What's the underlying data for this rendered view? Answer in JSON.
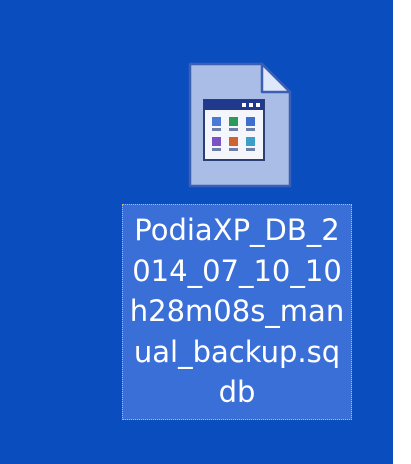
{
  "desktop": {
    "background_color": "#0a4dbe",
    "selected_file": {
      "icon": "database-file-icon",
      "name": "PodiaXP_DB_2014_07_10_10h28m08s_manual_backup.sqdb",
      "label_lines": [
        "PodiaXP_DB_2",
        "014_07_10_10",
        "h28m08s_man",
        "ual_backup.sq",
        "db"
      ],
      "selection_color": "#3a6fd8"
    }
  }
}
